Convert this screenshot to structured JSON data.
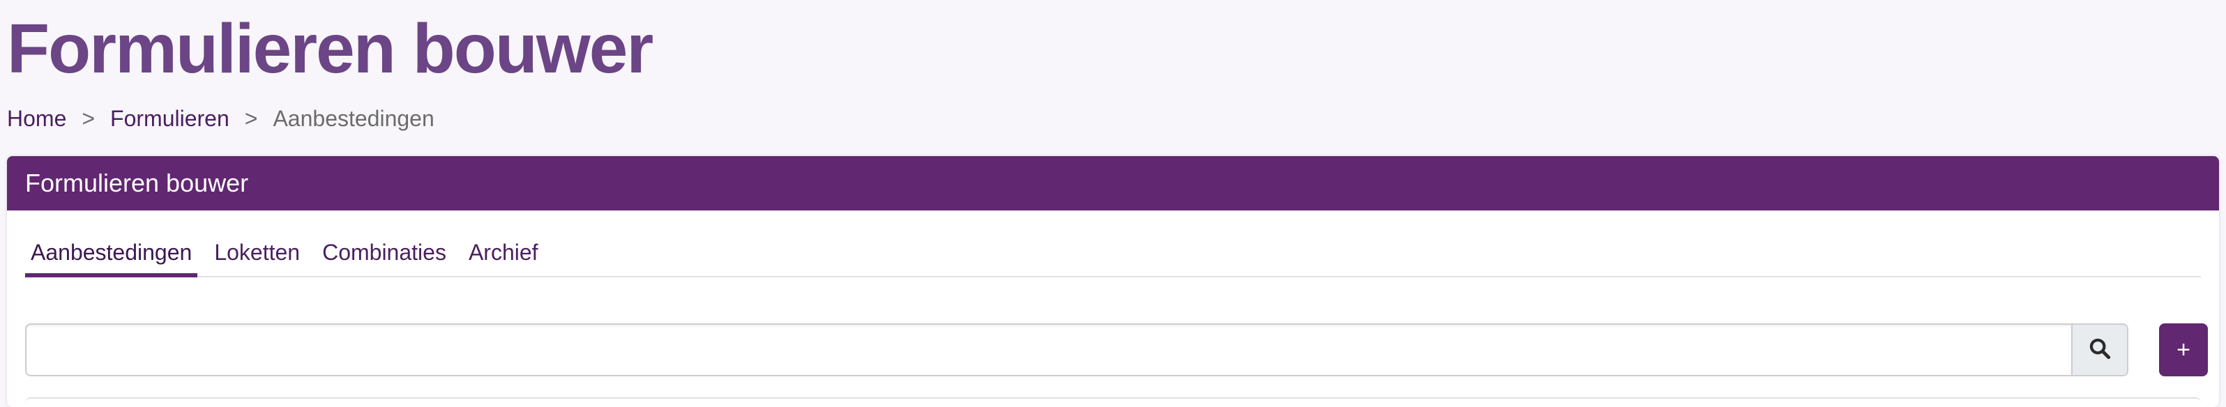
{
  "page": {
    "title": "Formulieren bouwer"
  },
  "breadcrumb": {
    "items": [
      {
        "label": "Home"
      },
      {
        "label": "Formulieren"
      },
      {
        "label": "Aanbestedingen"
      }
    ],
    "separator": ">"
  },
  "card": {
    "header_title": "Formulieren bouwer",
    "header_color": "#612770"
  },
  "tabs": [
    {
      "label": "Aanbestedingen",
      "active": true
    },
    {
      "label": "Loketten",
      "active": false
    },
    {
      "label": "Combinaties",
      "active": false
    },
    {
      "label": "Archief",
      "active": false
    }
  ],
  "search": {
    "value": "",
    "placeholder": "",
    "icon": "search-icon"
  },
  "add_button": {
    "label": "+"
  },
  "colors": {
    "accent": "#612770",
    "title": "#6b4585",
    "background": "#f8f6fa"
  }
}
